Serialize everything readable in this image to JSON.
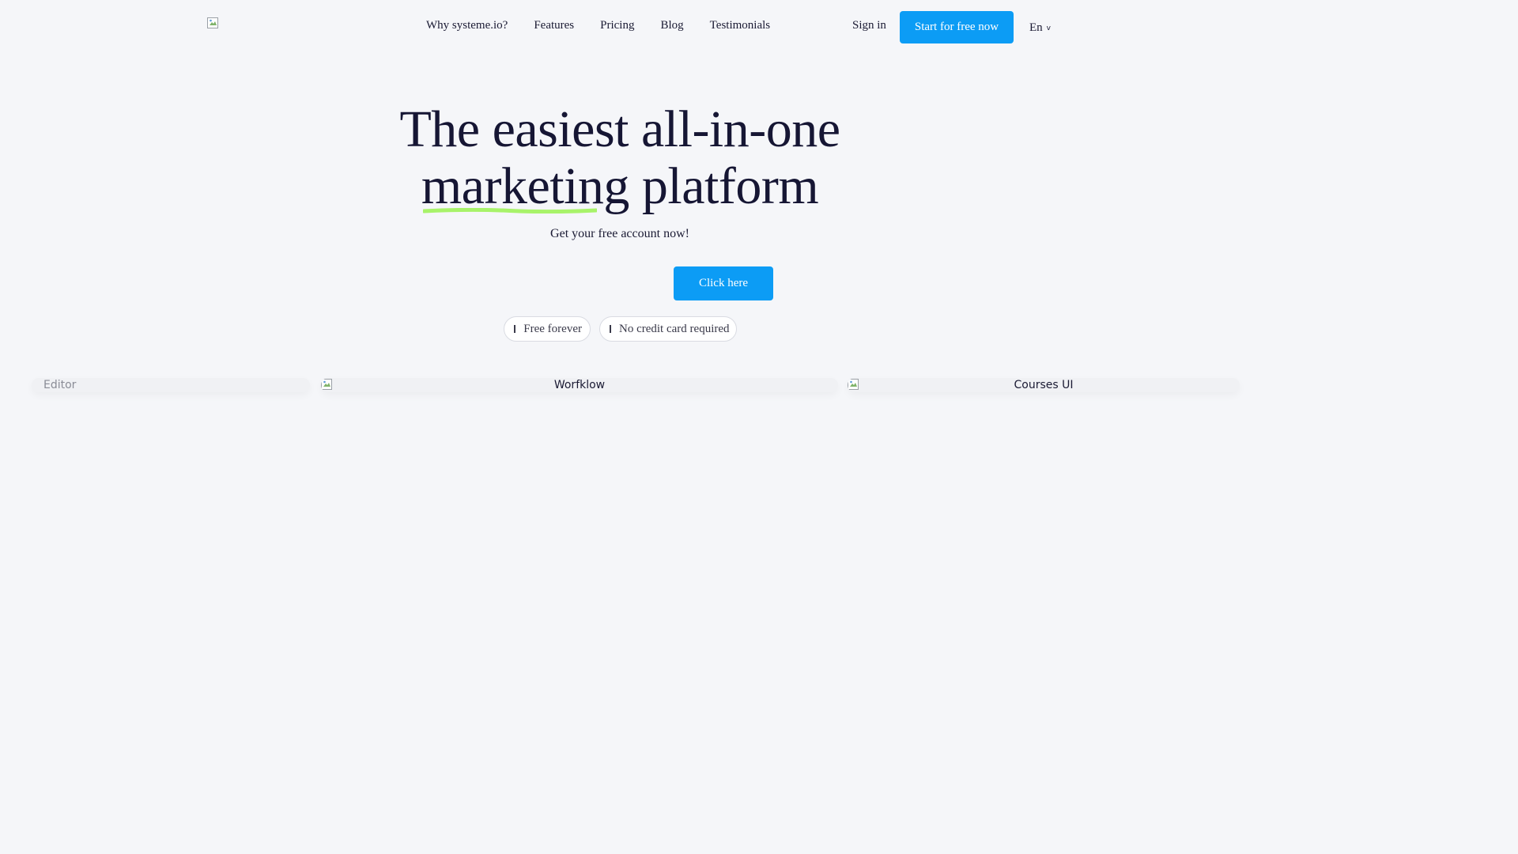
{
  "header": {
    "logo_alt": "",
    "nav": [
      {
        "label": "Why systeme.io?"
      },
      {
        "label": "Features"
      },
      {
        "label": "Pricing"
      },
      {
        "label": "Blog"
      },
      {
        "label": "Testimonials"
      }
    ],
    "signin_label": "Sign in",
    "cta_label": "Start for free now",
    "language": "En",
    "language_chevron": "v"
  },
  "hero": {
    "title_line1": "The easiest all-in-one",
    "title_highlight": "marketing",
    "title_rest": "platform",
    "subtitle": "Get your free account now!",
    "cta_label": "Click here",
    "badges": [
      {
        "label": "Free forever",
        "icon": "check-icon"
      },
      {
        "label": "No credit card required",
        "icon": "check-icon"
      }
    ]
  },
  "screens": [
    {
      "alt": "Editor"
    },
    {
      "alt": "Worfklow"
    },
    {
      "alt": "Courses UI"
    }
  ],
  "colors": {
    "background": "#f5f6f9",
    "primary": "#0c9cf5",
    "text": "#161634",
    "highlight": "#a8f36a"
  }
}
